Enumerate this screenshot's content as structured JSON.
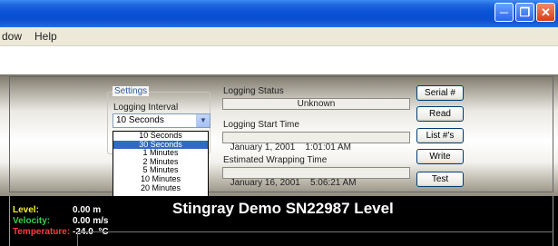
{
  "menu": {
    "items": [
      "dow",
      "Help"
    ]
  },
  "settings": {
    "group_title": "Settings",
    "interval_label": "Logging Interval",
    "interval_value": "10 Seconds",
    "options": [
      "10 Seconds",
      "30 Seconds",
      "1 Minutes",
      "2 Minutes",
      "5 Minutes",
      "10 Minutes",
      "20 Minutes"
    ],
    "highlighted_option": "30 Seconds"
  },
  "logging": {
    "status_label": "Logging Status",
    "status_value": "Unknown",
    "start_label": "Logging Start Time",
    "start_value": "January 1, 2001    1:01:01 AM",
    "wrap_label": "Estimated Wrapping Time",
    "wrap_value": "January 16, 2001    5:06:21 AM"
  },
  "buttons": {
    "serial": "Serial #",
    "read": "Read",
    "lists": "List #'s",
    "write": "Write",
    "test": "Test"
  },
  "display": {
    "level_label": "Level:",
    "level_value": "0.00 m",
    "velocity_label": "Velocity:",
    "velocity_value": "0.00 m/s",
    "temperature_label": "Temperature:",
    "temperature_value": "-24.0  °C",
    "title": "Stingray Demo SN22987 Level"
  },
  "colors": {
    "level": "#f3f02a",
    "velocity": "#35d14a",
    "temperature": "#ff3b3b",
    "selection": "#316ac5"
  }
}
